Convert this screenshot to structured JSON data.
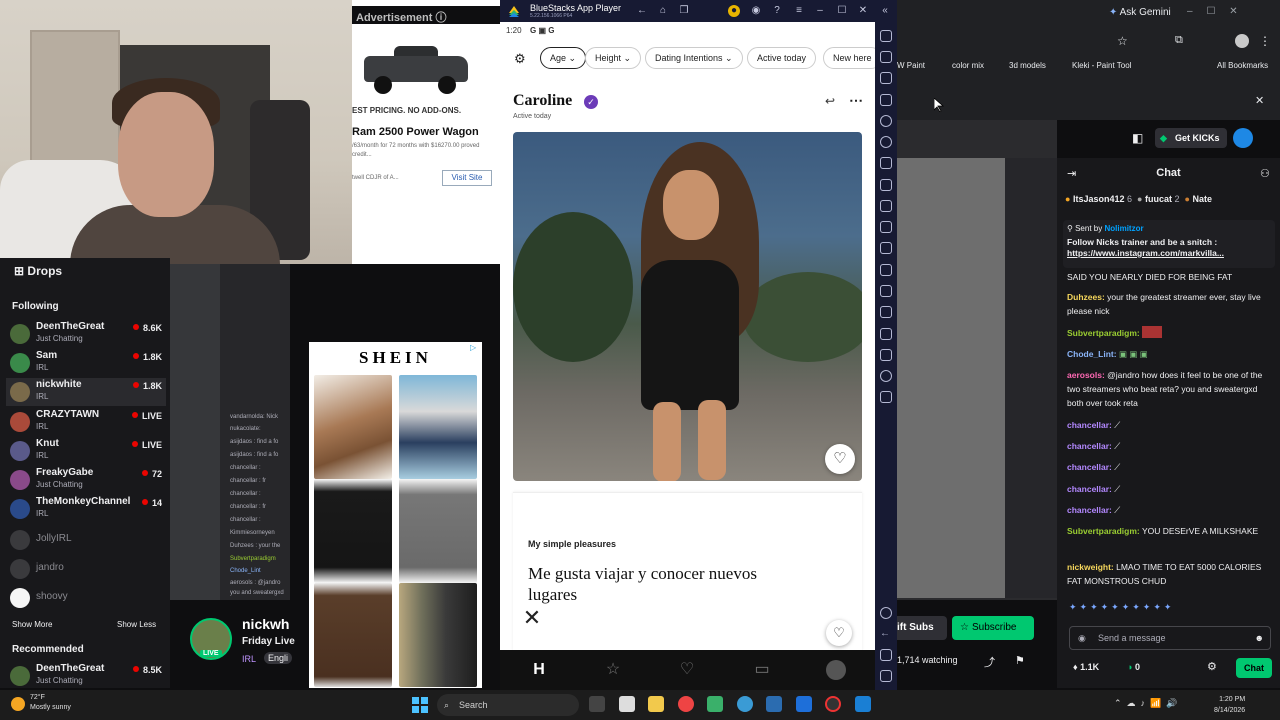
{
  "ad": {
    "header": "Advertisement",
    "banner": "EST PRICING. NO ADD-ONS.",
    "title": "Ram 2500 Power Wagon",
    "desc": "/63/month for 72 months with $16270.00 proved credit...",
    "footer": "twell CDJR of A...",
    "visit": "Visit Site"
  },
  "shein": {
    "logo": "SHEIN"
  },
  "leftnav": {
    "drops": "Drops",
    "following": "Following",
    "channels": [
      {
        "name": "DeenTheGreat",
        "sub": "Just Chatting",
        "viewers": "8.6K",
        "color": "#4a6a3a"
      },
      {
        "name": "Sam",
        "sub": "IRL",
        "viewers": "1.8K",
        "color": "#3a8a4a"
      },
      {
        "name": "nickwhite",
        "sub": "IRL",
        "viewers": "1.8K",
        "color": "#7a6a4a"
      },
      {
        "name": "CRAZYTAWN",
        "sub": "IRL",
        "viewers": "LIVE",
        "color": "#aa4a3a"
      },
      {
        "name": "Knut",
        "sub": "IRL",
        "viewers": "LIVE",
        "color": "#5a5a8a"
      },
      {
        "name": "FreakyGabe",
        "sub": "Just Chatting",
        "viewers": "72",
        "color": "#8a4a8a"
      },
      {
        "name": "TheMonkeyChannel",
        "sub": "IRL",
        "viewers": "14",
        "color": "#2a4a8a"
      }
    ],
    "offline": [
      "JollyIRL",
      "jandro",
      "shoovy"
    ],
    "show_more": "Show More",
    "show_less": "Show Less",
    "recommended": "Recommended",
    "rec": {
      "name": "DeenTheGreat",
      "sub": "Just Chatting",
      "viewers": "8.5K"
    }
  },
  "midchat": [
    "vandarnolda: Nick",
    "nukacolate:",
    "asijdaos : find a fo",
    "asijdaos : find a fo",
    "chancellar :",
    "chancellar : fr",
    "chancellar :",
    "chancellar : fr",
    "chancellar :",
    "Kimmiesorneyen",
    "Duhzees : your the",
    "Subvertparadigm",
    "Chode_Lint",
    "aerosols : @jandro",
    "you and sweatergxd"
  ],
  "streaminfo": {
    "name": "nickwh",
    "title": "Friday Live",
    "category": "IRL",
    "lang": "Engli",
    "live": "LIVE"
  },
  "bluestacks": {
    "title": "BlueStacks App Player",
    "version": "5.22.156.1066 P64",
    "time": "1:20",
    "status_icons": "G  ▣  G"
  },
  "hinge": {
    "filters": [
      "Age",
      "Height",
      "Dating Intentions",
      "Active today",
      "New here"
    ],
    "name": "Caroline",
    "active": "Active today",
    "prompt_q": "My simple pleasures",
    "prompt_a": "Me gusta viajar y conocer nuevos lugares"
  },
  "browser": {
    "gemini": "Ask Gemini",
    "bookmarks": [
      "W Paint",
      "color mix",
      "3d models",
      "Kleki - Paint Tool",
      "All Bookmarks"
    ]
  },
  "twitch": {
    "get_kicks": "Get KICKs",
    "chat_title": "Chat",
    "gifters": [
      {
        "name": "ItsJason412",
        "count": "6"
      },
      {
        "name": "fuucat",
        "count": "2"
      },
      {
        "name": "Nate",
        "count": ""
      }
    ],
    "pinned_sender_label": "Sent by",
    "pinned_sender": "Nolimitzor",
    "pinned_msg": "Follow Nicks trainer and be a snitch :",
    "pinned_url": "https://www.instagram.com/markvilla...",
    "messages": [
      {
        "user": "",
        "text": "SAID YOU NEARLY DIED FOR BEING FAT",
        "color": "#efeff1"
      },
      {
        "user": "Duhzees:",
        "text": " your the greatest streamer ever, stay live please nick",
        "color": "#f5d65c"
      },
      {
        "user": "Subvertparadigm:",
        "text": "",
        "color": "#9acd32"
      },
      {
        "user": "Chode_Lint:",
        "text": "",
        "color": "#8ab4f8"
      },
      {
        "user": "aerosols:",
        "text": " @jandro how does it feel to be one of the two streamers who beat reta? you and sweatergxd both over took reta",
        "color": "#ff69b4"
      },
      {
        "user": "chancellar:",
        "text": "",
        "color": "#b388ff"
      },
      {
        "user": "chancellar:",
        "text": "",
        "color": "#b388ff"
      },
      {
        "user": "chancellar:",
        "text": "",
        "color": "#b388ff"
      },
      {
        "user": "chancellar:",
        "text": "",
        "color": "#b388ff"
      },
      {
        "user": "chancellar:",
        "text": "",
        "color": "#b388ff"
      },
      {
        "user": "Subvertparadigm:",
        "text": " YOU DESErVE A MILKSHAKE",
        "color": "#9acd32"
      },
      {
        "user": "nickweight:",
        "text": " LMAO TIME TO EAT 5000 CALORIES FAT MONSTROUS CHUD",
        "color": "#f5d65c"
      }
    ],
    "input_placeholder": "Send a message",
    "points": "1.1K",
    "bits": "0",
    "chat_button": "Chat",
    "gift_subs": "ift Subs",
    "subscribe": "Subscribe",
    "watching": "1,714 watching"
  },
  "taskbar": {
    "temp": "72°F",
    "weather": "Mostly sunny",
    "search": "Search",
    "time": "1:20 PM",
    "date": "8/14/2026"
  }
}
